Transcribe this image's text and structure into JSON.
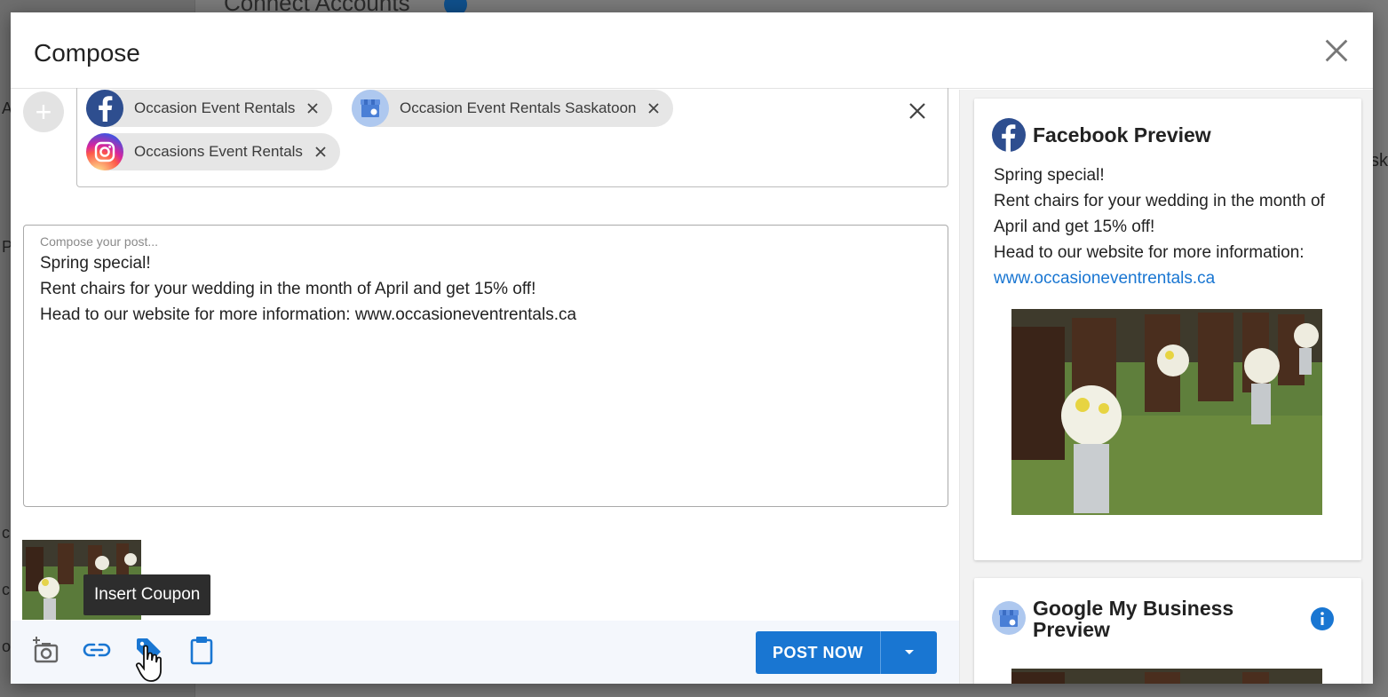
{
  "background": {
    "title": "Connect Accounts",
    "fragments": [
      "A",
      "P",
      "c",
      "cl",
      "o"
    ],
    "right_fragment": "sk"
  },
  "modal": {
    "title": "Compose"
  },
  "accounts": [
    {
      "label": "Occasion Event Rentals",
      "network": "facebook"
    },
    {
      "label": "Occasion Event Rentals Saskatoon",
      "network": "google-my-business"
    },
    {
      "label": "Occasions Event Rentals",
      "network": "instagram"
    }
  ],
  "compose": {
    "placeholder": "Compose your post...",
    "text": "Spring special!\nRent chairs for your wedding in the month of April and get 15% off!\nHead to our website for more information: www.occasioneventrentals.ca"
  },
  "tooltip": "Insert Coupon",
  "toolbar": {
    "post_now": "POST NOW"
  },
  "preview": {
    "facebook": {
      "title": "Facebook Preview",
      "lines": [
        "Spring special!",
        "Rent chairs for your wedding in the month of April and get 15% off!",
        "Head to our website for more information:"
      ],
      "link": "www.occasioneventrentals.ca"
    },
    "gmb": {
      "title_line1": "Google My Business",
      "title_line2": "Preview"
    }
  },
  "colors": {
    "accent": "#1976d2",
    "facebook": "#2e4e8f",
    "gmb": "#aec8ef"
  }
}
